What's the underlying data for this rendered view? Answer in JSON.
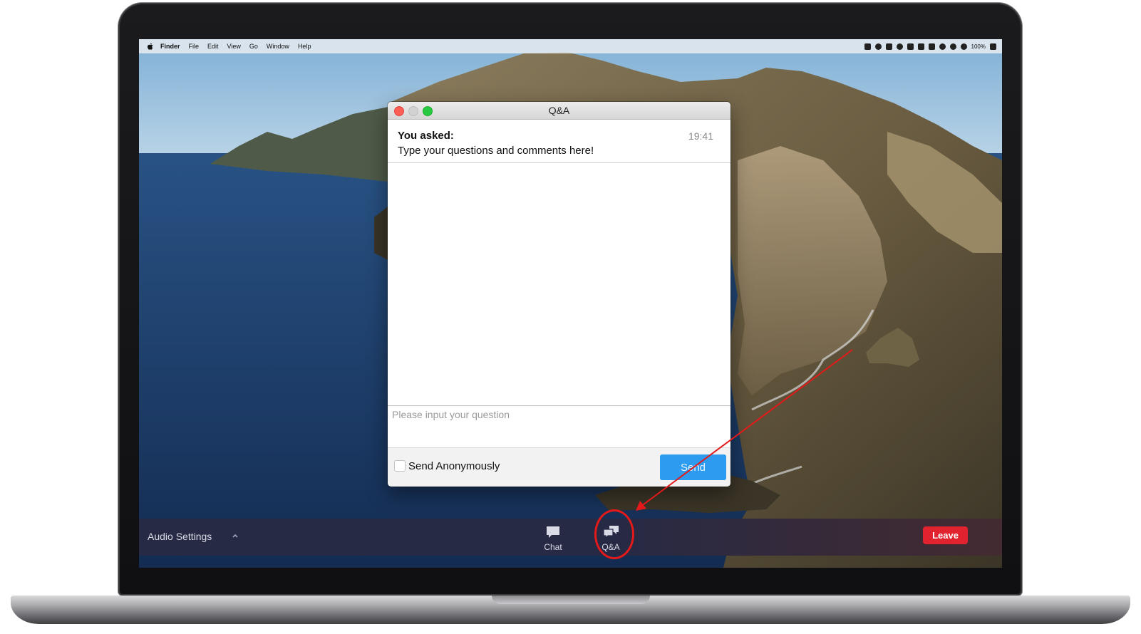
{
  "menubar": {
    "items": [
      "Finder",
      "File",
      "Edit",
      "View",
      "Go",
      "Window",
      "Help"
    ],
    "battery": "100%"
  },
  "qa_window": {
    "title": "Q&A",
    "question_label": "You asked:",
    "question_time": "19:41",
    "question_text": "Type your questions and comments here!",
    "input_placeholder": "Please input your question",
    "anonymous_label": "Send Anonymously",
    "send_label": "Send"
  },
  "toolbar": {
    "audio_settings": "Audio Settings",
    "chat_label": "Chat",
    "qa_label": "Q&A",
    "leave_label": "Leave"
  },
  "colors": {
    "send_button": "#2d9cf0",
    "leave_button": "#e0232e",
    "annotation": "#e41a1a"
  },
  "icons": [
    "apple-icon",
    "chevron-up-icon",
    "chat-icon",
    "qa-icon",
    "close-icon",
    "minimize-icon",
    "zoom-icon"
  ]
}
